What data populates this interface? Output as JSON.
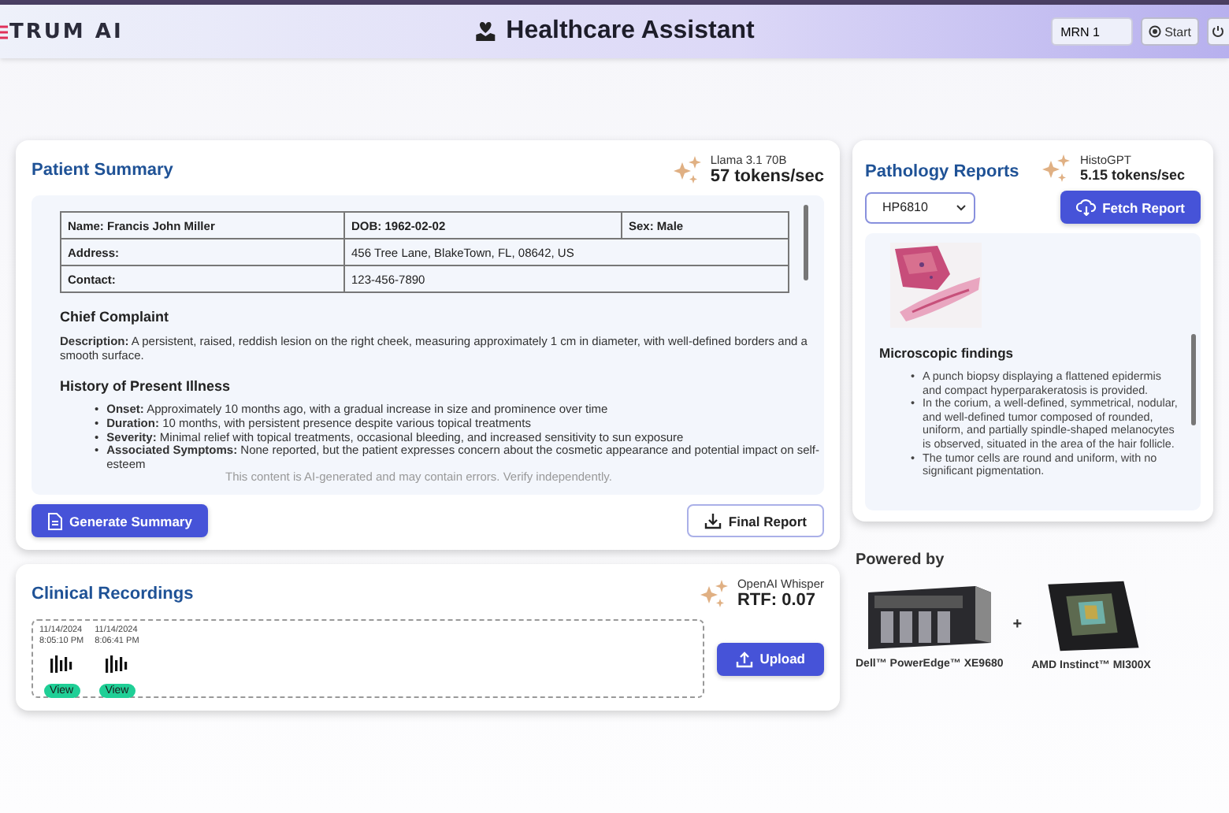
{
  "header": {
    "logo": "TRUM AI",
    "title": "Healthcare Assistant",
    "mrn_field": {
      "value": "MRN 1"
    },
    "start_button": "Start"
  },
  "patient_summary": {
    "title": "Patient Summary",
    "model": {
      "name": "Llama 3.1 70B",
      "speed": "57 tokens/sec"
    },
    "table": [
      [
        {
          "text": "Name: Francis John Miller",
          "bold": true
        },
        {
          "text": "DOB: 1962-02-02",
          "bold": true
        },
        {
          "text": "Sex: Male",
          "bold": true
        }
      ],
      [
        {
          "text": "Address:",
          "bold": true
        },
        {
          "text": "456 Tree Lane, BlakeTown, FL, 08642, US",
          "bold": false
        }
      ],
      [
        {
          "text": "Contact:",
          "bold": true
        },
        {
          "text": "123-456-7890",
          "bold": false
        }
      ]
    ],
    "sections": [
      {
        "heading": "Chief Complaint",
        "kind": "paragraph",
        "items": [
          "**Description:** A persistent, raised, reddish lesion on the right cheek, measuring approximately 1 cm in diameter, with well-defined borders and a smooth surface."
        ]
      },
      {
        "heading": "History of Present Illness",
        "kind": "list",
        "bullet": "•",
        "items": [
          "**Onset:** Approximately 10 months ago, with a gradual increase in size and prominence over time",
          "**Duration:** 10 months, with persistent presence despite various topical treatments",
          "**Severity:** Minimal relief with topical treatments, occasional bleeding, and increased sensitivity to sun exposure",
          "**Associated Symptoms:** None reported, but the patient expresses concern about the cosmetic appearance and potential impact on self-esteem"
        ]
      }
    ],
    "disclaimer": "This content is AI-generated and may contain errors. Verify independently.",
    "generate_button": "Generate Summary",
    "report_button": "Final Report"
  },
  "clinical_recordings": {
    "title": "Clinical Recordings",
    "model": {
      "name": "OpenAI Whisper",
      "speed": "RTF: 0.07"
    },
    "recordings": [
      {
        "date": "11/14/2024",
        "time": "8:05:10 PM",
        "action": "View"
      },
      {
        "date": "11/14/2024",
        "time": "8:06:41 PM",
        "action": "View"
      }
    ],
    "upload_button": "Upload"
  },
  "pathology_reports": {
    "title": "Pathology Reports",
    "model": {
      "name": "HistoGPT",
      "speed": "5.15 tokens/sec"
    },
    "case_select": "HP6810",
    "fetch_button": "Fetch Report",
    "heading": "Microscopic findings",
    "bullet": "•",
    "findings": [
      "A punch biopsy displaying a flattened epidermis and compact hyperparakeratosis is provided.",
      "In the corium, a well-defined, symmetrical, nodular, and well-defined tumor composed of rounded, uniform, and partially spindle-shaped melanocytes is observed, situated in the area of the hair follicle.",
      "The tumor cells are round and uniform, with no significant pigmentation."
    ]
  },
  "powered_by": {
    "title": "Powered by",
    "products": [
      {
        "name": "Dell™ PowerEdge™ XE9680",
        "kind": "server"
      },
      {
        "name": "AMD Instinct™ MI300X",
        "kind": "chip"
      }
    ],
    "joiner": "+"
  }
}
